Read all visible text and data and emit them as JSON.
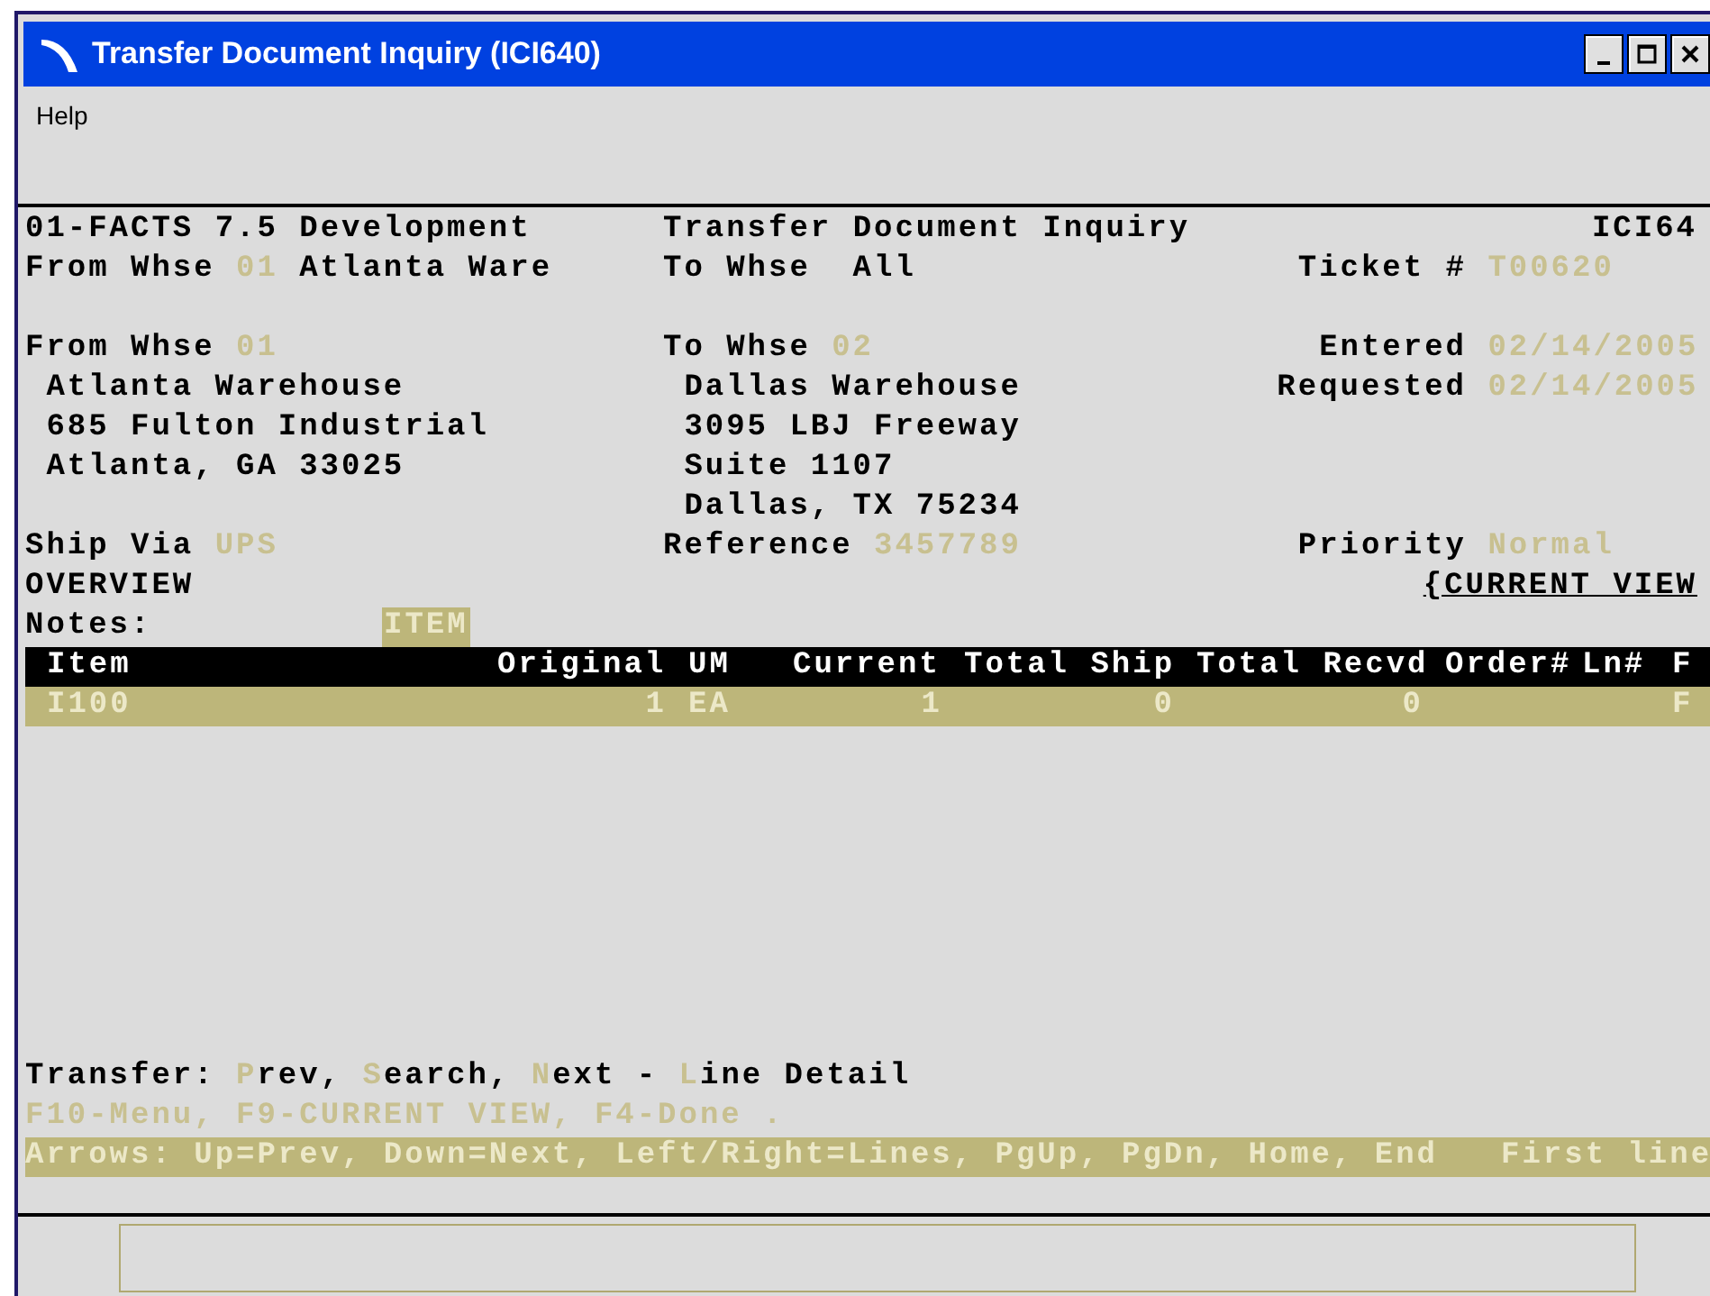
{
  "window": {
    "title": "Transfer Document Inquiry (ICI640)"
  },
  "menu": [
    "Help"
  ],
  "header": {
    "company": "01-FACTS 7.5 Development",
    "screen_title": "Transfer Document Inquiry",
    "program": "ICI64"
  },
  "filter": {
    "from_label": "From Whse",
    "from_code": "01",
    "from_name": "Atlanta Ware",
    "to_label": "To Whse",
    "to_value": "All",
    "ticket_label": "Ticket #",
    "ticket_value": "T00620"
  },
  "from": {
    "label": "From Whse",
    "code": "01",
    "lines": [
      "Atlanta Warehouse",
      "685 Fulton Industrial",
      "Atlanta, GA 33025"
    ]
  },
  "to": {
    "label": "To Whse",
    "code": "02",
    "lines": [
      "Dallas Warehouse",
      "3095 LBJ Freeway",
      "Suite 1107",
      "Dallas, TX 75234"
    ]
  },
  "dates": [
    {
      "label": "Entered",
      "value": "02/14/2005"
    },
    {
      "label": "Requested",
      "value": "02/14/2005"
    }
  ],
  "ship_via": {
    "label": "Ship Via",
    "value": "UPS"
  },
  "reference": {
    "label": "Reference",
    "value": "3457789"
  },
  "priority": {
    "label": "Priority",
    "value": "Normal"
  },
  "overview": "OVERVIEW",
  "view_link": "{CURRENT VIEW",
  "notes": {
    "label": "Notes:",
    "tag": "ITEM"
  },
  "table": {
    "columns": [
      "Item",
      "Original",
      "UM",
      "Current",
      "Total Ship",
      "Total Recvd",
      "Order#",
      "Ln#",
      "F"
    ],
    "rows": [
      {
        "selected": true,
        "cells": [
          "I100",
          "1",
          "EA",
          "1",
          "0",
          "0",
          "",
          "",
          "F"
        ]
      }
    ]
  },
  "prompt": [
    {
      "text": "Transfer: ",
      "hotkey": false
    },
    {
      "text": "P",
      "hotkey": true
    },
    {
      "text": "rev, ",
      "hotkey": false
    },
    {
      "text": "S",
      "hotkey": true
    },
    {
      "text": "earch, ",
      "hotkey": false
    },
    {
      "text": "N",
      "hotkey": true
    },
    {
      "text": "ext - ",
      "hotkey": false
    },
    {
      "text": "L",
      "hotkey": true
    },
    {
      "text": "ine Detail",
      "hotkey": false
    }
  ],
  "function_keys": "F10-Menu, F9-CURRENT VIEW, F4-Done .",
  "help_line": {
    "text": "Arrows: Up=Prev, Down=Next, Left/Right=Lines, PgUp, PgDn, Home, End",
    "message": "First line"
  }
}
